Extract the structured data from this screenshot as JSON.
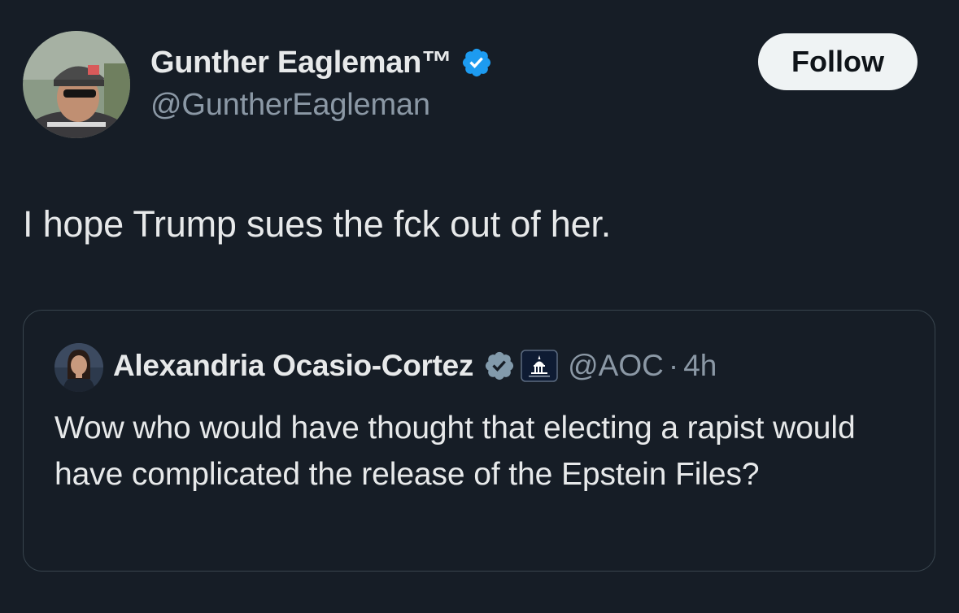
{
  "tweet": {
    "author": {
      "display_name": "Gunther Eagleman™",
      "handle": "@GuntherEagleman",
      "verified": true
    },
    "follow_label": "Follow",
    "text": "I hope Trump sues the fck out of her.",
    "quoted": {
      "display_name": "Alexandria Ocasio-Cortez",
      "handle": "@AOC",
      "separator": "·",
      "time": "4h",
      "verified": true,
      "affiliate_badge": "capitol-icon",
      "text": "Wow who would have thought that electing a rapist would have complicated the release of the Epstein Files?"
    }
  },
  "colors": {
    "background": "#161d26",
    "primary_text": "#e7e9ea",
    "secondary_text": "#8b98a5",
    "verified_blue": "#1d9bf0",
    "verified_gray": "#829aab",
    "border": "#38444d"
  },
  "icons": {
    "verified": "verified-badge-icon",
    "gray_verified": "gray-verified-badge-icon",
    "affiliate": "capitol-icon"
  }
}
